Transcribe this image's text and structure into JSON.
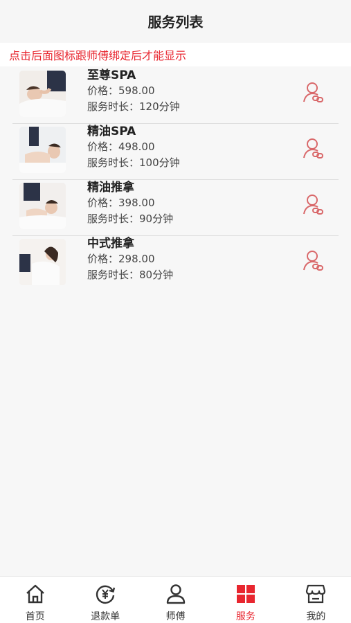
{
  "header": {
    "title": "服务列表"
  },
  "notice": {
    "text": "点击后面图标跟师傅绑定后才能显示"
  },
  "services": [
    {
      "name": "至尊SPA",
      "price": "价格：598.00",
      "duration": "服务时长：120分钟",
      "image": "spa-massage-photo"
    },
    {
      "name": "精油SPA",
      "price": "价格：498.00",
      "duration": "服务时长：100分钟",
      "image": "oil-back-massage-photo"
    },
    {
      "name": "精油推拿",
      "price": "价格：398.00",
      "duration": "服务时长：90分钟",
      "image": "oil-massage-photo"
    },
    {
      "name": "中式推拿",
      "price": "价格：298.00",
      "duration": "服务时长：80分钟",
      "image": "chinese-massage-photo"
    }
  ],
  "tabbar": {
    "items": [
      {
        "label": "首页",
        "icon": "home-icon",
        "active": false
      },
      {
        "label": "退款单",
        "icon": "refund-icon",
        "active": false
      },
      {
        "label": "师傅",
        "icon": "user-icon",
        "active": false
      },
      {
        "label": "服务",
        "icon": "grid-icon",
        "active": true
      },
      {
        "label": "我的",
        "icon": "store-icon",
        "active": false
      }
    ]
  },
  "colors": {
    "accent": "#e8262f",
    "bind_icon": "#d9686a",
    "text": "#222222"
  }
}
